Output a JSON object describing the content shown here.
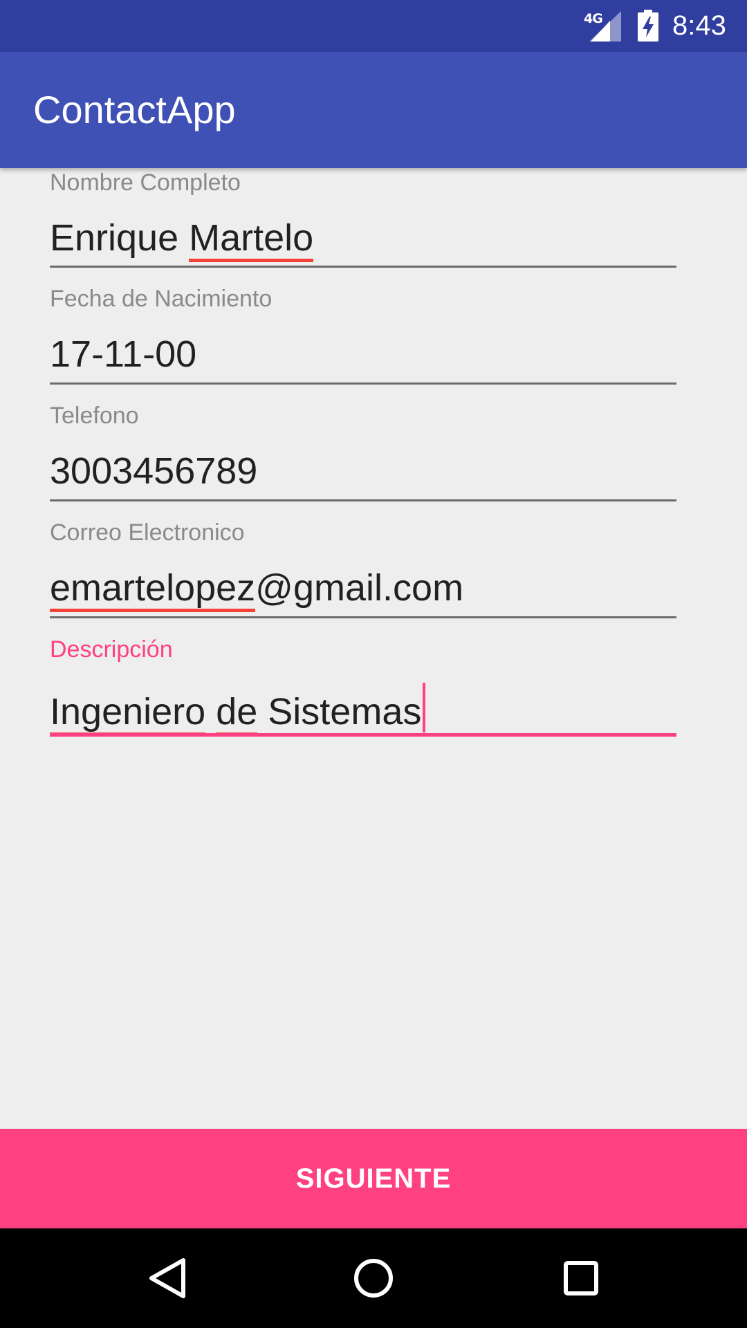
{
  "status_bar": {
    "network": "4G",
    "time": "8:43"
  },
  "app_bar": {
    "title": "ContactApp"
  },
  "form": {
    "fields": [
      {
        "label": "Nombre Completo",
        "value_parts": [
          "Enrique ",
          "Martelo"
        ]
      },
      {
        "label": "Fecha de Nacimiento",
        "value": "17-11-00"
      },
      {
        "label": "Telefono",
        "value": "3003456789"
      },
      {
        "label": "Correo Electronico",
        "value_parts": [
          "emartelopez",
          "@gmail.com"
        ]
      },
      {
        "label": "Descripción",
        "value_parts": [
          "Ingeniero",
          " ",
          "de",
          " Sistemas"
        ]
      }
    ]
  },
  "actions": {
    "next_label": "SIGUIENTE"
  },
  "colors": {
    "status_bar": "#303f9f",
    "app_bar": "#3f51b5",
    "accent": "#ff4081",
    "background": "#eeeeee",
    "spellcheck_underline": "#f44336"
  },
  "icons": {
    "status": [
      "signal-icon",
      "battery-charging-icon"
    ],
    "nav": [
      "back-icon",
      "home-icon",
      "recents-icon"
    ]
  }
}
